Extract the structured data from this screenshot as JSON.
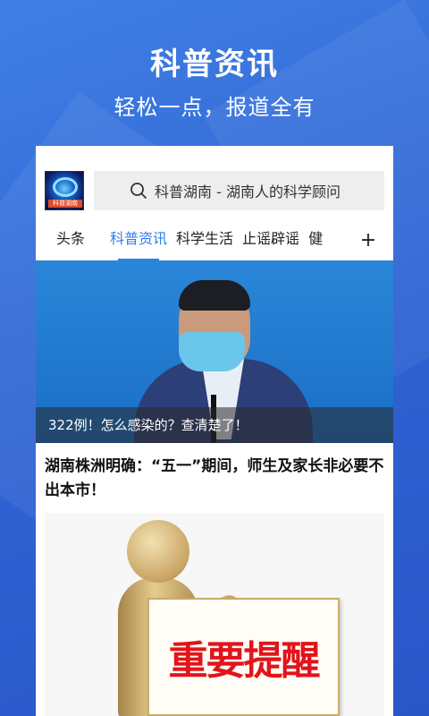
{
  "promo": {
    "title": "科普资讯",
    "subtitle": "轻松一点，报道全有"
  },
  "app": {
    "logo_text": "科普湖南",
    "search_placeholder": "科普湖南 - 湖南人的科学顾问",
    "tabs": [
      {
        "label": "头条",
        "active": false
      },
      {
        "label": "科普资讯",
        "active": true
      },
      {
        "label": "科学生活",
        "active": false
      },
      {
        "label": "止谣辟谣",
        "active": false
      },
      {
        "label": "健",
        "active": false
      }
    ],
    "more_label": "+",
    "accent_color": "#2f7cf0"
  },
  "feed": {
    "featured_caption": "322例！怎么感染的？查清楚了！",
    "article_title": "湖南株洲明确：“五一”期间，师生及家长非必要不出本市！",
    "article_image_text": "重要提醒"
  }
}
